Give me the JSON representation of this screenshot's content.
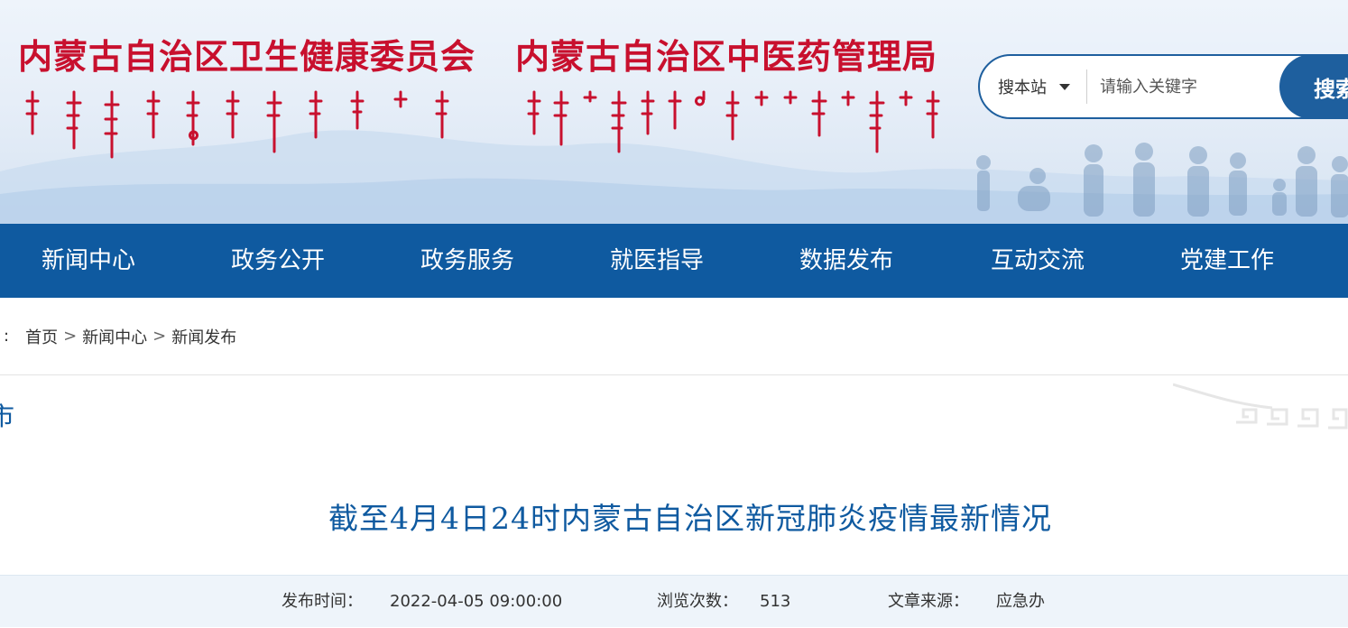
{
  "header": {
    "title_primary": "内蒙古自治区卫生健康委员会",
    "title_secondary": "内蒙古自治区中医药管理局",
    "title_color": "#c8102e",
    "mongolian_script_logo": "ᠥᠪᠥᠷ ᠮᠣᠩᠭᠣᠯ ᠤᠨ ᠥᠪᠡᠷᠲᠡᠭᠡᠨ ᠵᠠᠰᠠᠬᠤ ᠣᠷᠣᠨ ᠤ ᠡᠷᠡᠭᠦᠯ ᠮᠡᠨᠳᠦ"
  },
  "search": {
    "scope_label": "搜本站",
    "placeholder": "请输入关键字",
    "button_label": "搜索",
    "accent": "#1e5f9e"
  },
  "nav": {
    "background": "#0f5aa0",
    "items": [
      {
        "label": "新闻中心"
      },
      {
        "label": "政务公开"
      },
      {
        "label": "政务服务"
      },
      {
        "label": "就医指导"
      },
      {
        "label": "数据发布"
      },
      {
        "label": "互动交流"
      },
      {
        "label": "党建工作"
      }
    ]
  },
  "breadcrumb": {
    "prefix": ":",
    "items": [
      "首页",
      "新闻中心",
      "新闻发布"
    ],
    "separator": ">"
  },
  "section": {
    "title": "市"
  },
  "article": {
    "title": "截至4月4日24时内蒙古自治区新冠肺炎疫情最新情况",
    "publish_label": "发布时间：",
    "publish_value": "2022-04-05 09:00:00",
    "views_label": "浏览次数：",
    "views_value": "513",
    "source_label": "文章来源：",
    "source_value": "应急办"
  }
}
